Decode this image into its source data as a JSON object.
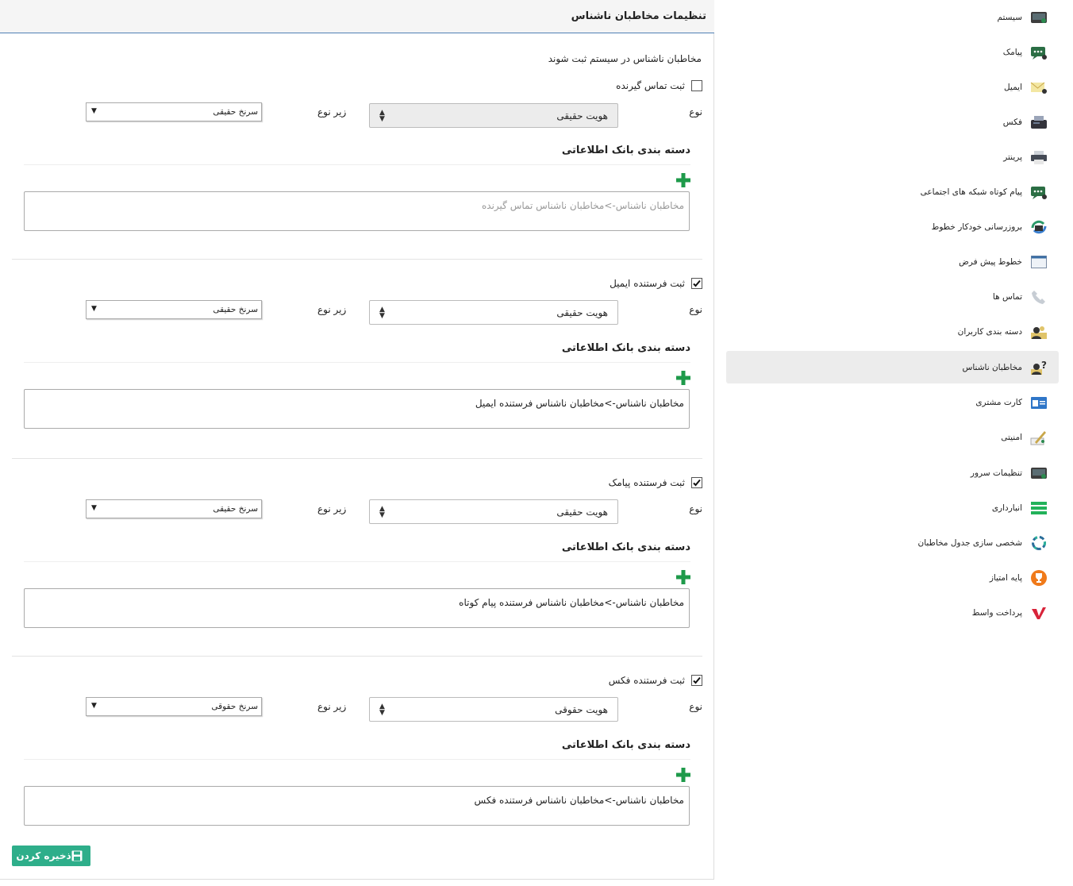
{
  "main": {
    "title": "تنظیمات مخاطبان ناشناس",
    "intro": "مخاطبان ناشناس در سیستم ثبت شوند",
    "type_label": "نوع",
    "subtype_label": "زیر نوع",
    "db_title": "دسته بندی بانک اطلاعاتی",
    "sections": [
      {
        "checkbox_label": "ثبت تماس گیرنده",
        "checked": false,
        "type_value": "هویت حقیقی",
        "subtype_value": "سرنخ حقیقی",
        "db_text": "مخاطبان ناشناس->مخاطبان ناشناس تماس گیرنده"
      },
      {
        "checkbox_label": "ثبت فرستنده ایمیل",
        "checked": true,
        "type_value": "هویت حقیقی",
        "subtype_value": "سرنخ حقیقی",
        "db_text": "مخاطبان ناشناس->مخاطبان ناشناس فرستنده ایمیل"
      },
      {
        "checkbox_label": "ثبت فرستنده پیامک",
        "checked": true,
        "type_value": "هویت حقیقی",
        "subtype_value": "سرنخ حقیقی",
        "db_text": "مخاطبان ناشناس->مخاطبان ناشناس فرستنده پیام کوتاه"
      },
      {
        "checkbox_label": "ثبت فرستنده فکس",
        "checked": true,
        "type_value": "هویت حقوقی",
        "subtype_value": "سرنخ حقوقی",
        "db_text": "مخاطبان ناشناس->مخاطبان ناشناس فرستنده فکس"
      }
    ],
    "save_label": "ذخیره کردن"
  },
  "sidebar": {
    "items": [
      {
        "label": "سیستم",
        "icon": "system-icon"
      },
      {
        "label": "پیامک",
        "icon": "sms-icon"
      },
      {
        "label": "ایمیل",
        "icon": "email-icon"
      },
      {
        "label": "فکس",
        "icon": "fax-icon"
      },
      {
        "label": "پرینتر",
        "icon": "printer-icon"
      },
      {
        "label": "پیام کوتاه شبکه های اجتماعی",
        "icon": "social-message-icon"
      },
      {
        "label": "بروزرسانی خودکار خطوط",
        "icon": "auto-update-icon"
      },
      {
        "label": "خطوط پیش فرض",
        "icon": "default-lines-icon"
      },
      {
        "label": "تماس ها",
        "icon": "calls-icon"
      },
      {
        "label": "دسته بندی کاربران",
        "icon": "user-groups-icon"
      },
      {
        "label": "مخاطبان ناشناس",
        "icon": "unknown-contacts-icon",
        "active": true
      },
      {
        "label": "کارت مشتری",
        "icon": "customer-card-icon"
      },
      {
        "label": "امنیتی",
        "icon": "security-icon"
      },
      {
        "label": "تنظیمات سرور",
        "icon": "server-settings-icon"
      },
      {
        "label": "انبارداری",
        "icon": "warehouse-icon"
      },
      {
        "label": "شخصی سازی جدول مخاطبان",
        "icon": "customize-table-icon"
      },
      {
        "label": "پایه امتیاز",
        "icon": "score-base-icon"
      },
      {
        "label": "پرداخت واسط",
        "icon": "payment-gateway-icon"
      }
    ]
  },
  "colors": {
    "accent": "#2eae8a",
    "header_border": "#4f7fb4",
    "active_item_bg": "#ececec"
  }
}
